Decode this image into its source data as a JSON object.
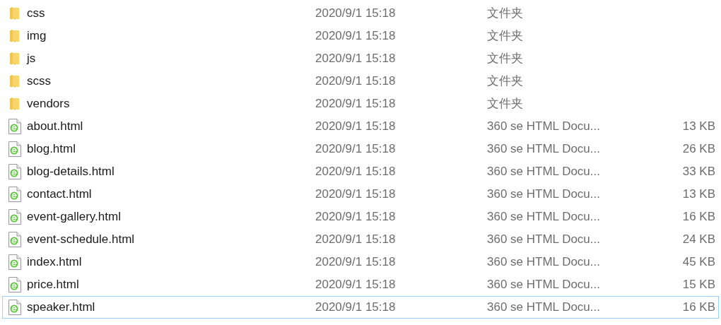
{
  "files": [
    {
      "kind": "folder",
      "name": "css",
      "modified": "2020/9/1 15:18",
      "type": "文件夹",
      "focused": false
    },
    {
      "kind": "folder",
      "name": "img",
      "modified": "2020/9/1 15:18",
      "type": "文件夹",
      "focused": false
    },
    {
      "kind": "folder",
      "name": "js",
      "modified": "2020/9/1 15:18",
      "type": "文件夹",
      "focused": false
    },
    {
      "kind": "folder",
      "name": "scss",
      "modified": "2020/9/1 15:18",
      "type": "文件夹",
      "focused": false
    },
    {
      "kind": "folder",
      "name": "vendors",
      "modified": "2020/9/1 15:18",
      "type": "文件夹",
      "focused": false
    },
    {
      "kind": "html",
      "name": "about.html",
      "modified": "2020/9/1 15:18",
      "type": "360 se HTML Docu...",
      "size": "13 KB",
      "focused": false
    },
    {
      "kind": "html",
      "name": "blog.html",
      "modified": "2020/9/1 15:18",
      "type": "360 se HTML Docu...",
      "size": "26 KB",
      "focused": false
    },
    {
      "kind": "html",
      "name": "blog-details.html",
      "modified": "2020/9/1 15:18",
      "type": "360 se HTML Docu...",
      "size": "33 KB",
      "focused": false
    },
    {
      "kind": "html",
      "name": "contact.html",
      "modified": "2020/9/1 15:18",
      "type": "360 se HTML Docu...",
      "size": "13 KB",
      "focused": false
    },
    {
      "kind": "html",
      "name": "event-gallery.html",
      "modified": "2020/9/1 15:18",
      "type": "360 se HTML Docu...",
      "size": "16 KB",
      "focused": false
    },
    {
      "kind": "html",
      "name": "event-schedule.html",
      "modified": "2020/9/1 15:18",
      "type": "360 se HTML Docu...",
      "size": "24 KB",
      "focused": false
    },
    {
      "kind": "html",
      "name": "index.html",
      "modified": "2020/9/1 15:18",
      "type": "360 se HTML Docu...",
      "size": "45 KB",
      "focused": false
    },
    {
      "kind": "html",
      "name": "price.html",
      "modified": "2020/9/1 15:18",
      "type": "360 se HTML Docu...",
      "size": "15 KB",
      "focused": false
    },
    {
      "kind": "html",
      "name": "speaker.html",
      "modified": "2020/9/1 15:18",
      "type": "360 se HTML Docu...",
      "size": "16 KB",
      "focused": true
    }
  ]
}
